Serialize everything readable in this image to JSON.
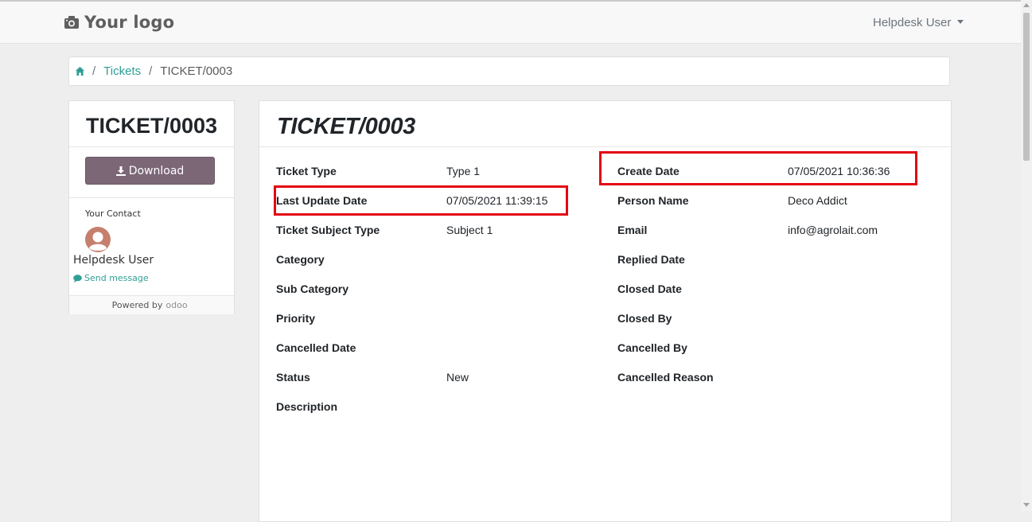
{
  "header": {
    "logo_text": "Your logo",
    "user_menu_label": "Helpdesk User"
  },
  "breadcrumb": {
    "tickets_label": "Tickets",
    "current_label": "TICKET/0003",
    "separator": "/"
  },
  "sidebar": {
    "title": "TICKET/0003",
    "download_label": "Download",
    "contact_heading": "Your Contact",
    "contact_name": "Helpdesk User",
    "send_message_label": "Send message",
    "powered_by_label": "Powered by",
    "odoo_text": "odoo"
  },
  "ticket": {
    "title": "TICKET/0003",
    "left_fields": [
      {
        "label": "Ticket Type",
        "value": "Type 1"
      },
      {
        "label": "Last Update Date",
        "value": "07/05/2021 11:39:15"
      },
      {
        "label": "Ticket Subject Type",
        "value": "Subject 1"
      },
      {
        "label": "Category",
        "value": ""
      },
      {
        "label": "Sub Category",
        "value": ""
      },
      {
        "label": "Priority",
        "value": ""
      },
      {
        "label": "Cancelled Date",
        "value": ""
      },
      {
        "label": "Status",
        "value": "New"
      },
      {
        "label": "Description",
        "value": ""
      }
    ],
    "right_fields": [
      {
        "label": "Create Date",
        "value": "07/05/2021 10:36:36"
      },
      {
        "label": "Person Name",
        "value": "Deco Addict"
      },
      {
        "label": "Email",
        "value": "info@agrolait.com"
      },
      {
        "label": "Replied Date",
        "value": ""
      },
      {
        "label": "Closed Date",
        "value": ""
      },
      {
        "label": "Closed By",
        "value": ""
      },
      {
        "label": "Cancelled By",
        "value": ""
      },
      {
        "label": "Cancelled Reason",
        "value": ""
      }
    ]
  },
  "colors": {
    "accent_link": "#2f9f96",
    "download_button": "#7c6777",
    "highlight_box": "#e30613"
  }
}
